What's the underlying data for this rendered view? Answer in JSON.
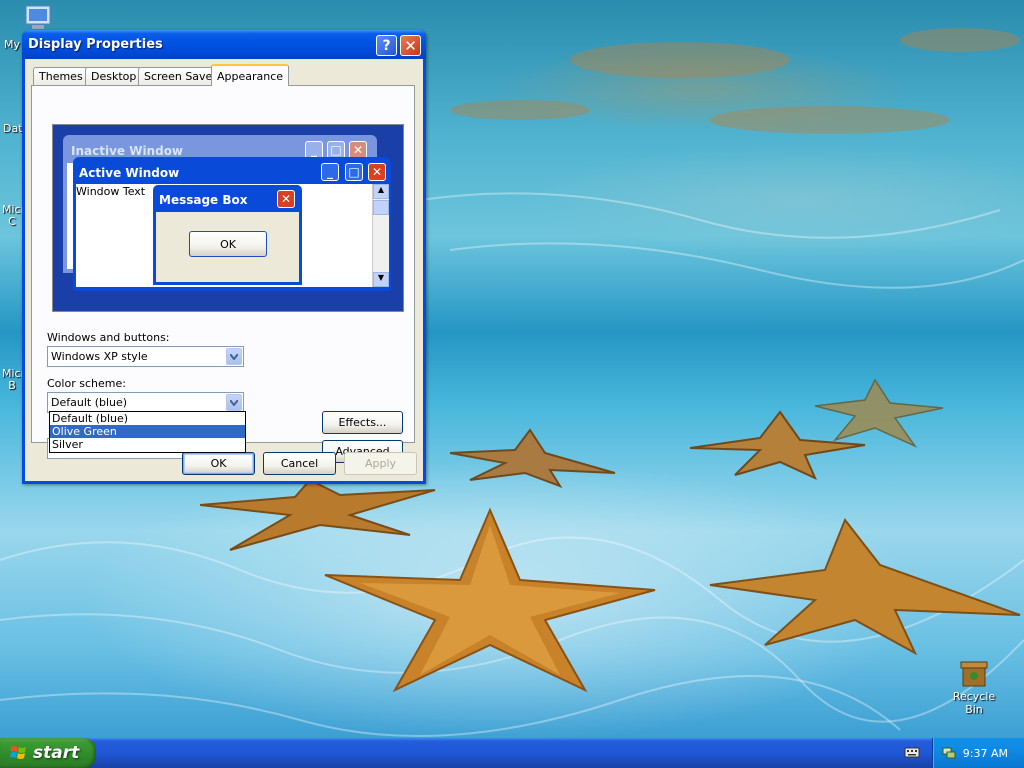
{
  "desktop": {
    "icons": [
      {
        "label": "My"
      },
      {
        "label": "Dat"
      },
      {
        "label": "Micr C"
      },
      {
        "label": "Micr B"
      }
    ],
    "recycle_bin_label": "Recycle Bin"
  },
  "dialog": {
    "title": "Display Properties",
    "help_label": "?",
    "close_label": "✕",
    "tabs": [
      {
        "label": "Themes"
      },
      {
        "label": "Desktop"
      },
      {
        "label": "Screen Saver"
      },
      {
        "label": "Appearance"
      }
    ],
    "active_tab": "Appearance",
    "preview": {
      "inactive_window_title": "Inactive Window",
      "active_window_title": "Active Window",
      "window_text": "Window Text",
      "message_box_title": "Message Box",
      "message_box_ok": "OK"
    },
    "windows_and_buttons": {
      "label": "Windows and buttons:",
      "value": "Windows XP style"
    },
    "color_scheme": {
      "label": "Color scheme:",
      "value": "Default (blue)",
      "options": [
        "Default (blue)",
        "Olive Green",
        "Silver"
      ],
      "highlighted": "Olive Green"
    },
    "effects_label": "Effects...",
    "advanced_label": "Advanced",
    "ok_label": "OK",
    "cancel_label": "Cancel",
    "apply_label": "Apply"
  },
  "taskbar": {
    "start_label": "start",
    "clock": "9:37 AM"
  },
  "colors": {
    "taskbar_blue": "#245edb",
    "start_green": "#3c9b35",
    "title_blue": "#0054e3",
    "selection_blue": "#316ac5"
  }
}
